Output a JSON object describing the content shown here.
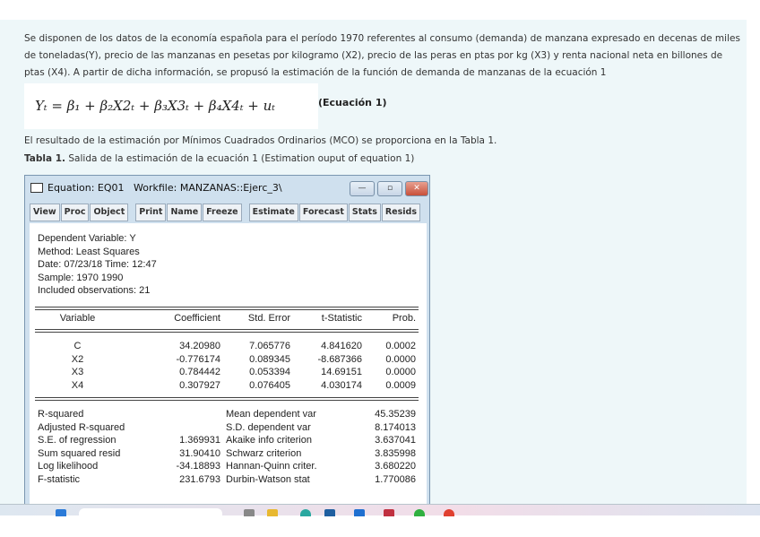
{
  "intro": {
    "line1": "Se disponen de los datos de la economía española para el período 1970 referentes al consumo (demanda) de manzana expresado en decenas de miles",
    "line2": "de toneladas(Y), precio de las manzanas  en pesetas por kilogramo (X2), precio de las peras en ptas por kg (X3) y renta nacional neta en billones de",
    "line3": "ptas (X4). A partir de dicha información, se propusó la estimación de la función de demanda de manzanas de la ecuación 1"
  },
  "equation": {
    "formula": "Yₜ = β₁ + β₂X2ₜ + β₃X3ₜ + β₄X4ₜ + uₜ",
    "label": "(Ecuación 1)"
  },
  "result_text": "El resultado de la estimación por Mínimos Cuadrados Ordinarios (MCO) se proporciona en la Tabla 1.",
  "caption": {
    "bold": "Tabla 1.",
    "text": " Salida de la estimación de la ecuación 1 (Estimation ouput of equation 1)"
  },
  "window": {
    "title": "Equation: EQ01   Workfile: MANZANAS::Ejerc_3\\",
    "toolbar": [
      "View",
      "Proc",
      "Object",
      "Print",
      "Name",
      "Freeze",
      "Estimate",
      "Forecast",
      "Stats",
      "Resids"
    ],
    "header": [
      "Dependent Variable: Y",
      "Method: Least Squares",
      "Date: 07/23/18   Time: 12:47",
      "Sample: 1970 1990",
      "Included observations: 21"
    ],
    "columns": [
      "Variable",
      "Coefficient",
      "Std. Error",
      "t-Statistic",
      "Prob."
    ],
    "rows": [
      [
        "C",
        "34.20980",
        "7.065776",
        "4.841620",
        "0.0002"
      ],
      [
        "X2",
        "-0.776174",
        "0.089345",
        "-8.687366",
        "0.0000"
      ],
      [
        "X3",
        "0.784442",
        "0.053394",
        "14.69151",
        "0.0000"
      ],
      [
        "X4",
        "0.307927",
        "0.076405",
        "4.030174",
        "0.0009"
      ]
    ],
    "stats": [
      [
        "R-squared",
        "",
        "Mean dependent var",
        "45.35239"
      ],
      [
        "Adjusted R-squared",
        "",
        "S.D. dependent var",
        "8.174013"
      ],
      [
        "S.E. of regression",
        "1.369931",
        "Akaike info criterion",
        "3.637041"
      ],
      [
        "Sum squared resid",
        "31.90410",
        "Schwarz criterion",
        "3.835998"
      ],
      [
        "Log likelihood",
        "-34.18893",
        "Hannan-Quinn criter.",
        "3.680220"
      ],
      [
        "F-statistic",
        "231.6793",
        "Durbin-Watson stat",
        "1.770086"
      ]
    ]
  }
}
